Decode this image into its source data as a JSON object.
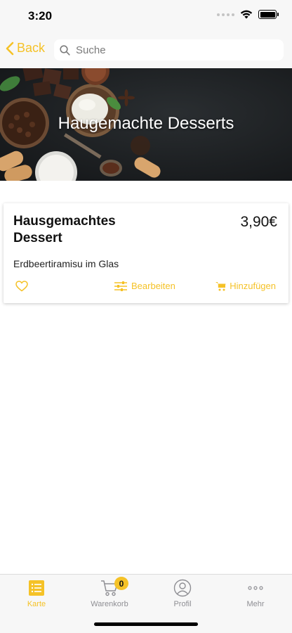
{
  "status_bar": {
    "time": "3:20"
  },
  "nav": {
    "back_label": "Back",
    "search_placeholder": "Suche",
    "search_value": ""
  },
  "hero": {
    "title": "Haugemachte Desserts"
  },
  "product": {
    "title": "Hausgemachtes Dessert",
    "price": "3,90€",
    "description": "Erdbeertiramisu im Glas",
    "edit_label": "Bearbeiten",
    "add_label": "Hinzufügen"
  },
  "tab_bar": {
    "tabs": [
      {
        "label": "Karte",
        "icon": "menu-list-icon",
        "active": true
      },
      {
        "label": "Warenkorb",
        "icon": "cart-icon",
        "badge": "0"
      },
      {
        "label": "Profil",
        "icon": "profile-icon"
      },
      {
        "label": "Mehr",
        "icon": "more-dots-icon"
      }
    ]
  },
  "colors": {
    "accent": "#f5c227",
    "bar_background": "#f7f7f7",
    "inactive": "#8e8e93"
  }
}
